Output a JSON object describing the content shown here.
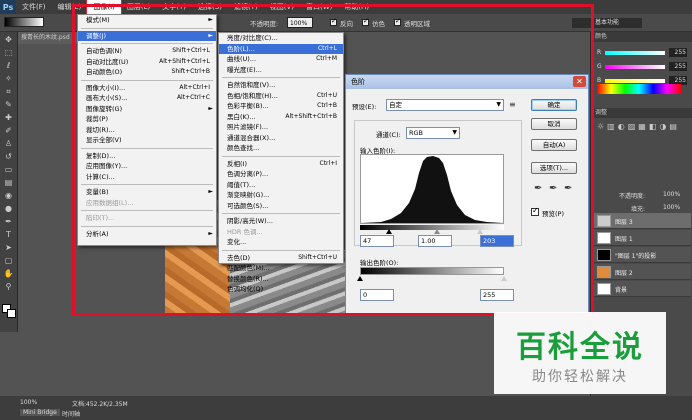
{
  "menubar": {
    "logo": "Ps",
    "items": [
      "文件(F)",
      "编辑(E)",
      "图像(I)",
      "图层(L)",
      "文字(Y)",
      "选择(S)",
      "滤镜(T)",
      "视图(V)",
      "窗口(W)",
      "帮助(H)"
    ]
  },
  "workspace": {
    "essentials": "基本功能"
  },
  "options": {
    "opacity_label": "不透明度:",
    "opacity_value": "100%",
    "reverse": "反向",
    "dither": "仿色",
    "transparency": "透明区域"
  },
  "document": {
    "tab": "搜青长的木纹.psd"
  },
  "image_menu": {
    "rows": [
      {
        "label": "模式(M)",
        "arrow": "►"
      },
      {
        "sep": true
      },
      {
        "label": "调整(J)",
        "arrow": "►",
        "hl": true
      },
      {
        "sep": true
      },
      {
        "label": "自动色调(N)",
        "shortcut": "Shift+Ctrl+L"
      },
      {
        "label": "自动对比度(U)",
        "shortcut": "Alt+Shift+Ctrl+L"
      },
      {
        "label": "自动颜色(O)",
        "shortcut": "Shift+Ctrl+B"
      },
      {
        "sep": true
      },
      {
        "label": "图像大小(I)...",
        "shortcut": "Alt+Ctrl+I"
      },
      {
        "label": "画布大小(S)...",
        "shortcut": "Alt+Ctrl+C"
      },
      {
        "label": "图像旋转(G)",
        "arrow": "►"
      },
      {
        "label": "裁剪(P)"
      },
      {
        "label": "裁切(R)..."
      },
      {
        "label": "显示全部(V)"
      },
      {
        "sep": true
      },
      {
        "label": "复制(D)..."
      },
      {
        "label": "应用图像(Y)..."
      },
      {
        "label": "计算(C)..."
      },
      {
        "sep": true
      },
      {
        "label": "变量(B)",
        "arrow": "►"
      },
      {
        "label": "应用数据组(L)...",
        "dis": true
      },
      {
        "sep": true
      },
      {
        "label": "陷印(T)...",
        "dis": true
      },
      {
        "sep": true
      },
      {
        "label": "分析(A)",
        "arrow": "►"
      }
    ]
  },
  "adjust_menu": {
    "rows": [
      {
        "label": "亮度/对比度(C)..."
      },
      {
        "label": "色阶(L)...",
        "shortcut": "Ctrl+L",
        "hl": true
      },
      {
        "label": "曲线(U)...",
        "shortcut": "Ctrl+M"
      },
      {
        "label": "曝光度(E)..."
      },
      {
        "sep": true
      },
      {
        "label": "自然饱和度(V)..."
      },
      {
        "label": "色相/饱和度(H)...",
        "shortcut": "Ctrl+U"
      },
      {
        "label": "色彩平衡(B)...",
        "shortcut": "Ctrl+B"
      },
      {
        "label": "黑白(K)...",
        "shortcut": "Alt+Shift+Ctrl+B"
      },
      {
        "label": "照片滤镜(F)..."
      },
      {
        "label": "通道混合器(X)..."
      },
      {
        "label": "颜色查找..."
      },
      {
        "sep": true
      },
      {
        "label": "反相(I)",
        "shortcut": "Ctrl+I"
      },
      {
        "label": "色调分离(P)..."
      },
      {
        "label": "阈值(T)..."
      },
      {
        "label": "渐变映射(G)..."
      },
      {
        "label": "可选颜色(S)..."
      },
      {
        "sep": true
      },
      {
        "label": "阴影/高光(W)..."
      },
      {
        "label": "HDR 色调...",
        "dis": true
      },
      {
        "label": "变化..."
      },
      {
        "sep": true
      },
      {
        "label": "去色(D)",
        "shortcut": "Shift+Ctrl+U"
      },
      {
        "label": "匹配颜色(M)..."
      },
      {
        "label": "替换颜色(R)..."
      },
      {
        "label": "色调均化(Q)"
      }
    ]
  },
  "levels": {
    "title": "色阶",
    "preset_label": "预设(E):",
    "preset_value": "自定",
    "channel_label": "通道(C):",
    "channel_value": "RGB",
    "input_label": "输入色阶(I):",
    "input_black": "47",
    "input_gamma": "1.00",
    "input_white": "203",
    "output_label": "输出色阶(O):",
    "output_black": "0",
    "output_white": "255",
    "ok": "确定",
    "cancel": "取消",
    "auto": "自动(A)",
    "options": "选项(T)...",
    "preview": "预览(P)"
  },
  "color_panel": {
    "tab": "颜色",
    "r_label": "R",
    "r_value": "255",
    "g_label": "G",
    "g_value": "255",
    "b_label": "B",
    "b_value": "255"
  },
  "adjust_panel": {
    "tab": "调整"
  },
  "layers_panel": {
    "opacity_label": "不透明度:",
    "opacity_value": "100%",
    "fill_label": "填充:",
    "fill_value": "100%",
    "layers": [
      {
        "name": "图层 3"
      },
      {
        "name": "图层 1"
      },
      {
        "name": "\"图层 1\"的投影"
      },
      {
        "name": "图层 2"
      },
      {
        "name": "背景"
      }
    ]
  },
  "status": {
    "zoom": "100%",
    "doc_info": "文档:452.2K/2.35M",
    "tab_minibridge": "Mini Bridge",
    "tab_timeline": "时间轴"
  },
  "watermark": {
    "title": "百科全说",
    "subtitle": "助你轻松解决"
  }
}
